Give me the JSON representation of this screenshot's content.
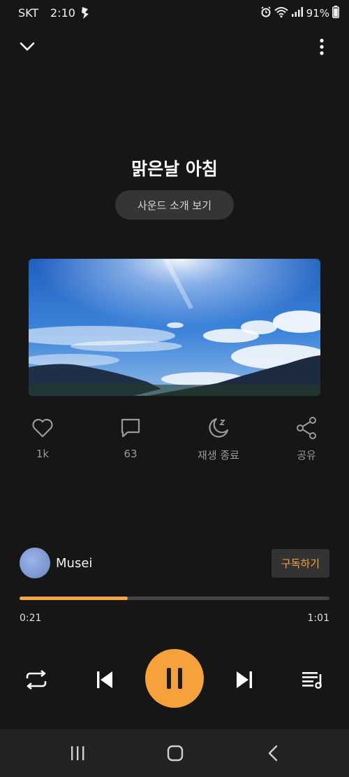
{
  "status_bar": {
    "carrier": "SKT",
    "time": "2:10",
    "battery": "91%",
    "icons": [
      "notification-icon",
      "alarm-icon",
      "wifi-icon",
      "signal-icon"
    ]
  },
  "header": {
    "collapse_icon": "chevron-down-icon",
    "menu_icon": "more-vert-icon"
  },
  "track": {
    "title": "맑은날 아침",
    "about_label": "사운드 소개 보기"
  },
  "actions": {
    "likes": "1k",
    "comments": "63",
    "sleep_timer": "재생 종료",
    "share": "공유"
  },
  "creator": {
    "name": "Musei",
    "subscribe_label": "구독하기"
  },
  "playback": {
    "elapsed": "0:21",
    "total": "1:01",
    "progress": 0.35
  },
  "colors": {
    "accent": "#f6a23c",
    "background": "#161616",
    "button_bg": "#353535"
  }
}
